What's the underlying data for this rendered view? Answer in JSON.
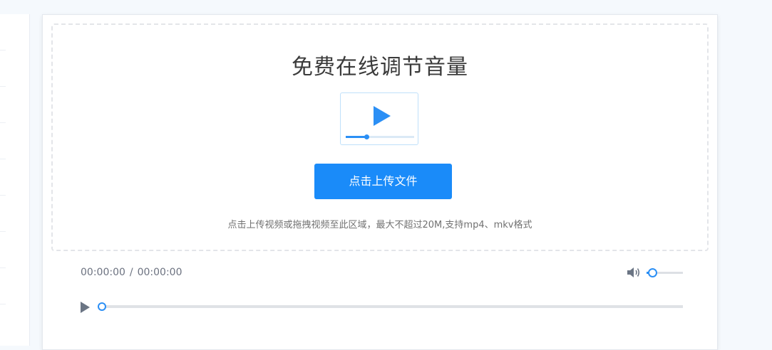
{
  "page": {
    "title": "免费在线调节音量",
    "upload_button_label": "点击上传文件",
    "hint": "点击上传视频或拖拽视频至此区域，最大不超过20M,支持mp4、mkv格式"
  },
  "illustration": {
    "icon": "video-play-icon",
    "progress_fraction": 0.3
  },
  "player": {
    "current_time": "00:00:00",
    "separator": "/",
    "total_time": "00:00:00",
    "play_icon": "play-icon",
    "volume_icon": "volume-icon",
    "volume_fraction": 0.15,
    "progress_fraction": 0.0
  },
  "colors": {
    "accent": "#1a8bf9",
    "text_title": "#3b3b3b",
    "text_muted": "#717171",
    "control_gray": "#6b7584"
  }
}
